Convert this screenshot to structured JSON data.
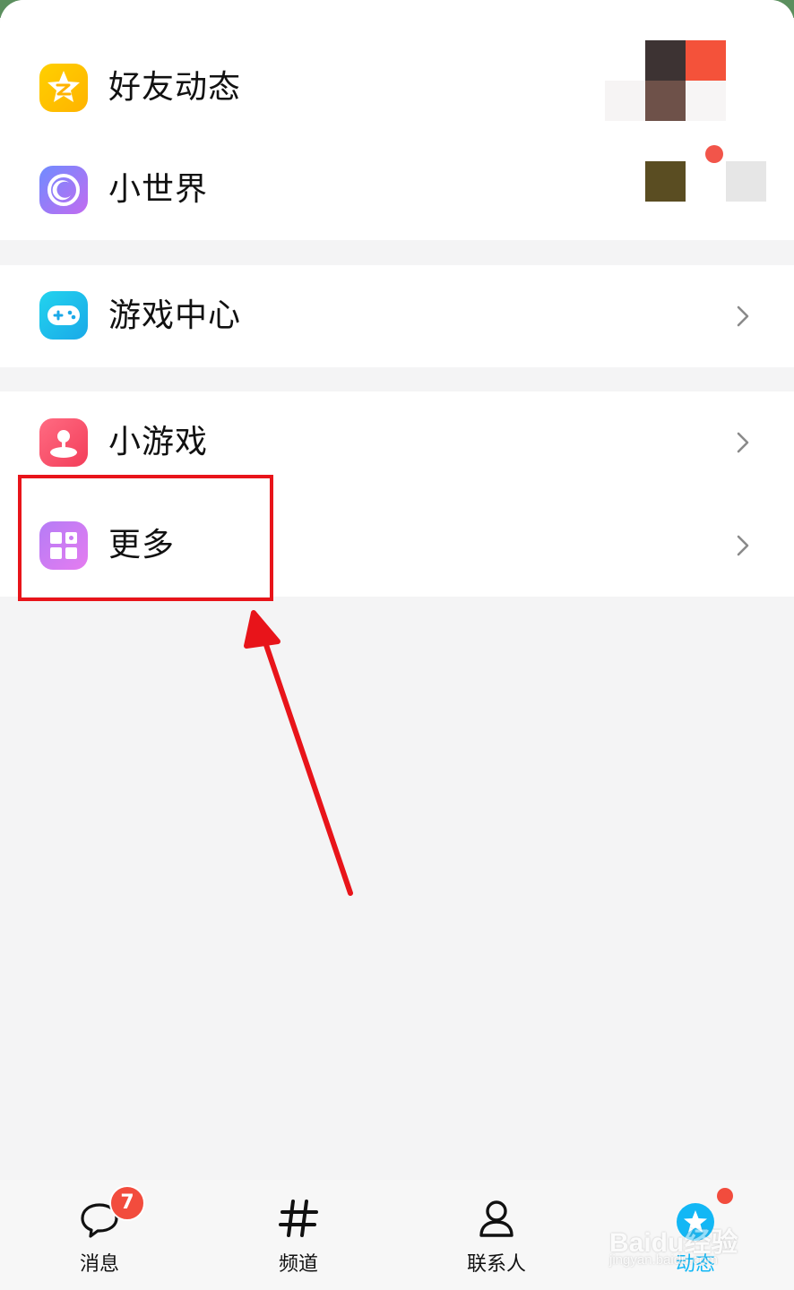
{
  "menu": {
    "friends_feed": {
      "label": "好友动态",
      "icon": "qzone-star-icon"
    },
    "small_world": {
      "label": "小世界",
      "icon": "small-world-icon"
    },
    "game_center": {
      "label": "游戏中心",
      "icon": "gamepad-icon"
    },
    "mini_games": {
      "label": "小游戏",
      "icon": "joystick-icon"
    },
    "more": {
      "label": "更多",
      "icon": "grid-icon"
    }
  },
  "tabbar": {
    "tabs": [
      {
        "label": "消息",
        "icon": "chat-bubble-icon",
        "badge": "7"
      },
      {
        "label": "频道",
        "icon": "hashtag-icon"
      },
      {
        "label": "联系人",
        "icon": "person-icon"
      },
      {
        "label": "动态",
        "icon": "star-planet-icon",
        "active": true
      }
    ]
  },
  "watermark": {
    "main": "Baidu经验",
    "sub": "jingyan.baidu.com"
  },
  "colors": {
    "accent": "#12b7f5",
    "annotation": "#e8141a",
    "badge": "#f24c3d",
    "background": "#f4f4f5"
  }
}
